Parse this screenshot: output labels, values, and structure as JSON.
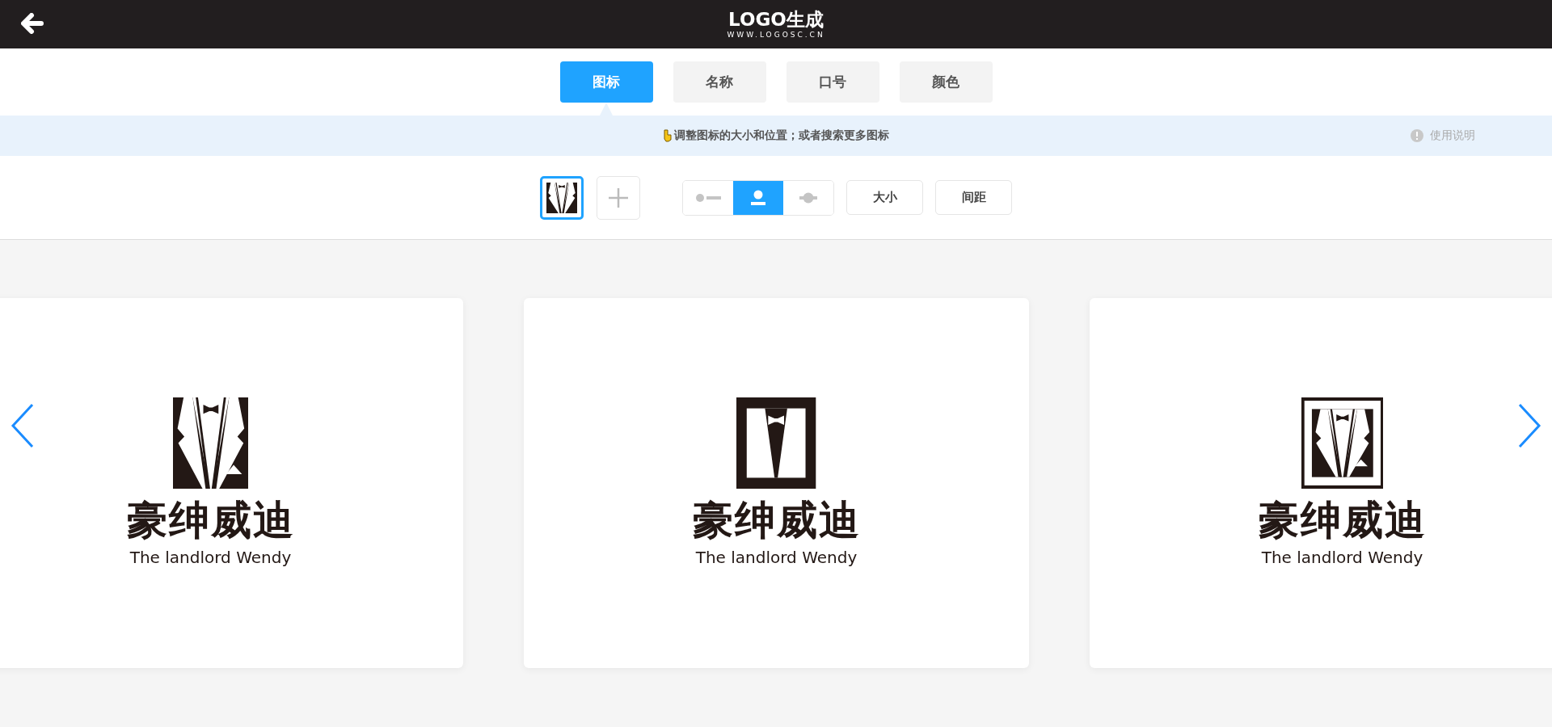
{
  "header": {
    "logo_title": "LOGO生成",
    "logo_url": "WWW.LOGOSC.CN"
  },
  "tabs": [
    {
      "label": "图标",
      "selected": true
    },
    {
      "label": "名称",
      "selected": false
    },
    {
      "label": "口号",
      "selected": false
    },
    {
      "label": "颜色",
      "selected": false
    }
  ],
  "hint_bar": {
    "text": "调整图标的大小和位置；或者搜索更多图标",
    "help": "使用说明"
  },
  "toolbar": {
    "layouts": [
      {
        "kind": "icon-left",
        "selected": false
      },
      {
        "kind": "icon-top",
        "selected": true
      },
      {
        "kind": "icon-behind",
        "selected": false
      }
    ],
    "buttons": [
      "大小",
      "间距"
    ]
  },
  "cards": [
    {
      "kind": "solid",
      "name": "豪绅威迪",
      "slogan": "The landlord Wendy"
    },
    {
      "kind": "frame",
      "name": "豪绅威迪",
      "slogan": "The landlord Wendy"
    },
    {
      "kind": "bordered",
      "name": "豪绅威迪",
      "slogan": "The landlord Wendy"
    }
  ]
}
